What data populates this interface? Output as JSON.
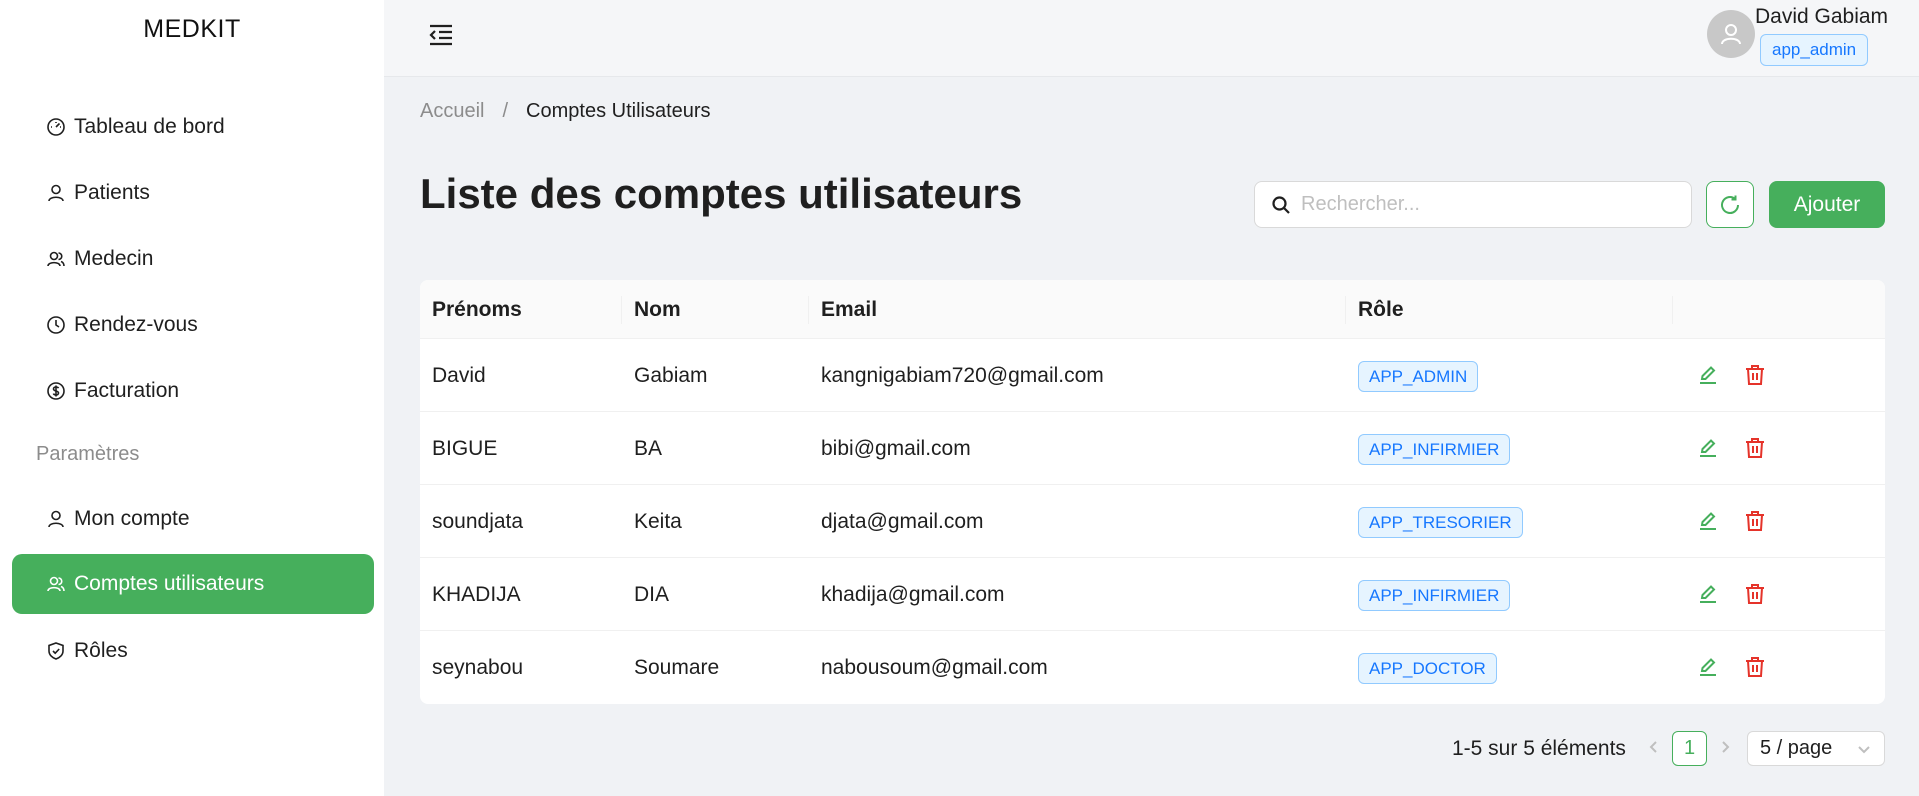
{
  "sidebar": {
    "brand": "MEDKIT",
    "items": [
      {
        "label": "Tableau de bord",
        "icon": "dashboard-icon"
      },
      {
        "label": "Patients",
        "icon": "user-icon"
      },
      {
        "label": "Medecin",
        "icon": "users-icon"
      },
      {
        "label": "Rendez-vous",
        "icon": "clock-icon"
      },
      {
        "label": "Facturation",
        "icon": "dollar-icon"
      }
    ],
    "group_label": "Paramètres",
    "settings_items": [
      {
        "label": "Mon compte",
        "icon": "user-icon"
      },
      {
        "label": "Comptes utilisateurs",
        "icon": "users-icon",
        "active": true
      },
      {
        "label": "Rôles",
        "icon": "shield-check-icon"
      }
    ]
  },
  "header": {
    "user_name": "David Gabiam",
    "user_role": "app_admin"
  },
  "breadcrumb": {
    "home": "Accueil",
    "separator": "/",
    "current": "Comptes Utilisateurs"
  },
  "page": {
    "title": "Liste des comptes utilisateurs",
    "search_placeholder": "Rechercher...",
    "add_label": "Ajouter"
  },
  "table": {
    "columns": [
      "Prénoms",
      "Nom",
      "Email",
      "Rôle"
    ],
    "rows": [
      {
        "prenom": "David",
        "nom": "Gabiam",
        "email": "kangnigabiam720@gmail.com",
        "role": "APP_ADMIN"
      },
      {
        "prenom": "BIGUE",
        "nom": "BA",
        "email": "bibi@gmail.com",
        "role": "APP_INFIRMIER"
      },
      {
        "prenom": "soundjata",
        "nom": "Keita",
        "email": "djata@gmail.com",
        "role": "APP_TRESORIER"
      },
      {
        "prenom": "KHADIJA",
        "nom": "DIA",
        "email": "khadija@gmail.com",
        "role": "APP_INFIRMIER"
      },
      {
        "prenom": "seynabou",
        "nom": "Soumare",
        "email": "nabousoum@gmail.com",
        "role": "APP_DOCTOR"
      }
    ]
  },
  "pagination": {
    "total_text": "1-5 sur 5 éléments",
    "current_page": "1",
    "page_size": "5 / page"
  },
  "colors": {
    "accent": "#46af5c",
    "tag_blue": "#1677ff",
    "delete_red": "#e5332a"
  }
}
